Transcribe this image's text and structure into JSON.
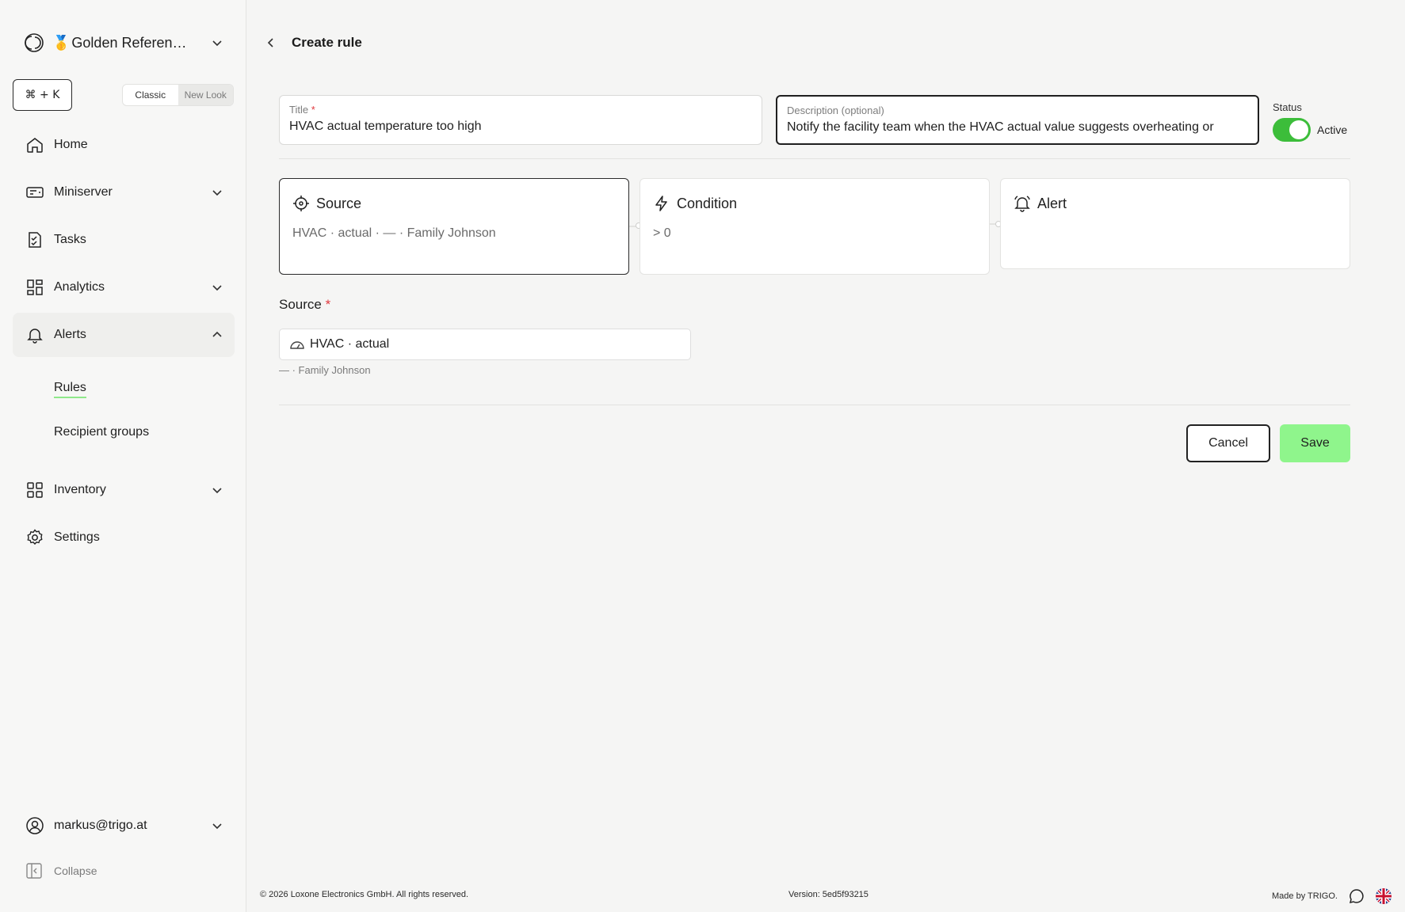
{
  "sidebar": {
    "workspace_name": "Golden Referen…",
    "workspace_emoji": "🥇",
    "shortcut": "⌘ + K",
    "look_toggle": {
      "classic": "Classic",
      "new_look": "New Look"
    },
    "items": [
      {
        "label": "Home",
        "icon": "home-icon"
      },
      {
        "label": "Miniserver",
        "icon": "miniserver-icon"
      },
      {
        "label": "Tasks",
        "icon": "tasks-icon"
      },
      {
        "label": "Analytics",
        "icon": "analytics-icon"
      },
      {
        "label": "Alerts",
        "icon": "bell-icon"
      },
      {
        "label": "Inventory",
        "icon": "grid-icon"
      },
      {
        "label": "Settings",
        "icon": "gear-icon"
      }
    ],
    "alerts_sub": [
      {
        "label": "Rules"
      },
      {
        "label": "Recipient groups"
      }
    ],
    "user": "markus@trigo.at",
    "collapse": "Collapse"
  },
  "header": {
    "title": "Create rule"
  },
  "form": {
    "title_label": "Title",
    "title_value": "HVAC actual temperature too high",
    "description_label": "Description (optional)",
    "description_value": "Notify the facility team when the HVAC actual value suggests overheating or",
    "status_label": "Status",
    "status_value": "Active"
  },
  "steps": [
    {
      "title": "Source",
      "subtitle": "HVAC · actual · — · Family Johnson",
      "icon": "crosshair-icon"
    },
    {
      "title": "Condition",
      "subtitle": "> 0",
      "icon": "lightning-icon"
    },
    {
      "title": "Alert",
      "subtitle": "",
      "icon": "alarm-bell-icon"
    }
  ],
  "source_section": {
    "label": "Source",
    "selected": "HVAC · actual",
    "hint": "— · Family Johnson"
  },
  "actions": {
    "cancel": "Cancel",
    "save": "Save"
  },
  "footer": {
    "copyright": "© 2026 Loxone Electronics GmbH. All rights reserved.",
    "version": "Version: 5ed5f93215",
    "made_by": "Made by TRIGO."
  },
  "colors": {
    "accent": "#8ff58c",
    "toggle_on": "#3cbd3a",
    "required": "#e0393e"
  }
}
